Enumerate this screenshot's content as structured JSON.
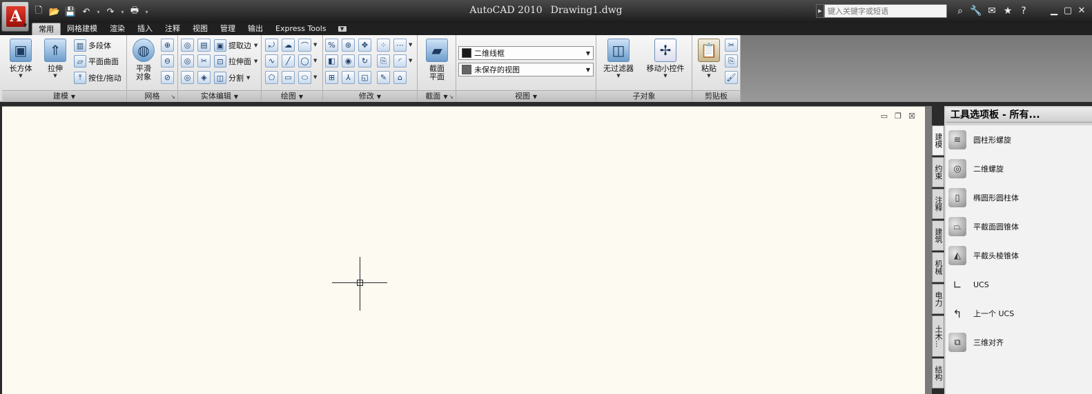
{
  "titlebar": {
    "app_name": "AutoCAD 2010",
    "document": "Drawing1.dwg",
    "search_placeholder": "键入关键字或短语"
  },
  "quick_access": {
    "icons": [
      "new-icon",
      "open-icon",
      "save-icon",
      "undo-icon",
      "redo-icon",
      "plot-icon",
      "dropdown-icon"
    ]
  },
  "tabs": [
    {
      "label": "常用",
      "active": true
    },
    {
      "label": "网格建模"
    },
    {
      "label": "渲染"
    },
    {
      "label": "插入"
    },
    {
      "label": "注释"
    },
    {
      "label": "视图"
    },
    {
      "label": "管理"
    },
    {
      "label": "输出"
    },
    {
      "label": "Express Tools"
    }
  ],
  "panels": {
    "modeling": {
      "title": "建模",
      "box": "长方体",
      "extrude": "拉伸",
      "polysolid": "多段体",
      "planar_surface": "平面曲面",
      "presspull": "按住/拖动"
    },
    "mesh": {
      "title": "网格",
      "smooth_object": [
        "平滑",
        "对象"
      ]
    },
    "solid_editing": {
      "title": "实体编辑",
      "extract_edges": "提取边",
      "extrude_faces": "拉伸面",
      "separate": "分割"
    },
    "draw": {
      "title": "绘图"
    },
    "modify": {
      "title": "修改"
    },
    "section": {
      "title": "截面",
      "section_plane": [
        "截面",
        "平面"
      ]
    },
    "view": {
      "title": "视图",
      "visual_style": "二维线框",
      "named_view": "未保存的视图"
    },
    "subobject": {
      "title": "子对象",
      "no_filter": "无过滤器",
      "move_gizmo": "移动小控件"
    },
    "clipboard": {
      "title": "剪贴板",
      "paste": "粘贴"
    }
  },
  "palette": {
    "title": "工具选项板 - 所有...",
    "tabs": [
      "建模",
      "约束",
      "注释",
      "建筑",
      "机械",
      "电力",
      "土木...",
      "结构"
    ],
    "items": [
      {
        "label": "圆柱形螺旋",
        "icon": "helix-icon"
      },
      {
        "label": "二维螺旋",
        "icon": "spiral-icon"
      },
      {
        "label": "椭圆形圆柱体",
        "icon": "elliptical-cylinder-icon"
      },
      {
        "label": "平截面圆锥体",
        "icon": "frustum-cone-icon"
      },
      {
        "label": "平截头棱锥体",
        "icon": "frustum-pyramid-icon"
      },
      {
        "label": "UCS",
        "icon": "ucs-icon"
      },
      {
        "label": "上一个 UCS",
        "icon": "ucs-previous-icon"
      },
      {
        "label": "三维对齐",
        "icon": "3d-align-icon"
      }
    ]
  }
}
